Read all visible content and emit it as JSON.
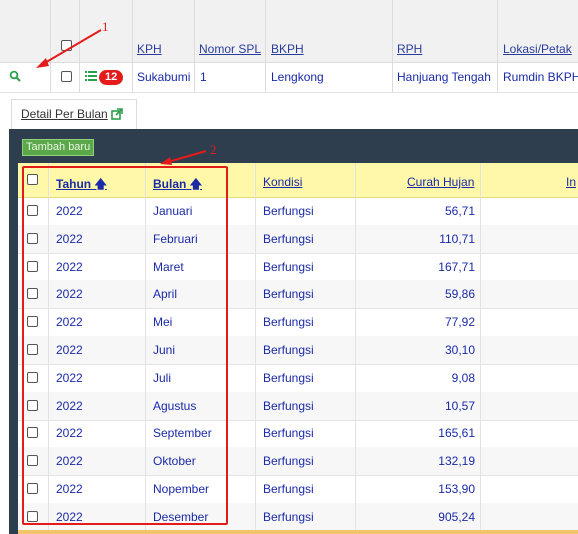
{
  "top_table": {
    "columns": [
      "KPH",
      "Nomor SPL",
      "BKPH",
      "RPH",
      "Lokasi/Petak"
    ],
    "row": {
      "badge_count": "12",
      "kph": "Sukabumi",
      "nomor_spl": "1",
      "bkph": "Lengkong",
      "rph": "Hanjuang Tengah",
      "lokasi": "Rumdin BKPH"
    }
  },
  "tab": {
    "label": "Detail Per Bulan"
  },
  "toolbar": {
    "add_label": "Tambah baru"
  },
  "detail_table": {
    "headers": {
      "tahun": "Tahun",
      "bulan": "Bulan",
      "kondisi": "Kondisi",
      "curah_hujan": "Curah Hujan",
      "next": "In"
    },
    "rows": [
      {
        "tahun": "2022",
        "bulan": "Januari",
        "kondisi": "Berfungsi",
        "curah": "56,71"
      },
      {
        "tahun": "2022",
        "bulan": "Februari",
        "kondisi": "Berfungsi",
        "curah": "110,71"
      },
      {
        "tahun": "2022",
        "bulan": "Maret",
        "kondisi": "Berfungsi",
        "curah": "167,71"
      },
      {
        "tahun": "2022",
        "bulan": "April",
        "kondisi": "Berfungsi",
        "curah": "59,86"
      },
      {
        "tahun": "2022",
        "bulan": "Mei",
        "kondisi": "Berfungsi",
        "curah": "77,92"
      },
      {
        "tahun": "2022",
        "bulan": "Juni",
        "kondisi": "Berfungsi",
        "curah": "30,10"
      },
      {
        "tahun": "2022",
        "bulan": "Juli",
        "kondisi": "Berfungsi",
        "curah": "9,08"
      },
      {
        "tahun": "2022",
        "bulan": "Agustus",
        "kondisi": "Berfungsi",
        "curah": "10,57"
      },
      {
        "tahun": "2022",
        "bulan": "September",
        "kondisi": "Berfungsi",
        "curah": "165,61"
      },
      {
        "tahun": "2022",
        "bulan": "Oktober",
        "kondisi": "Berfungsi",
        "curah": "132,19"
      },
      {
        "tahun": "2022",
        "bulan": "Nopember",
        "kondisi": "Berfungsi",
        "curah": "153,90"
      },
      {
        "tahun": "2022",
        "bulan": "Desember",
        "kondisi": "Berfungsi",
        "curah": "905,24"
      }
    ]
  },
  "annotations": {
    "label_1": "1",
    "label_2": "2"
  },
  "colors": {
    "accent_red": "#e31b1b",
    "header_yellow": "#fff8a8",
    "link_blue": "#1a2aa8",
    "panel_dark": "#2f3e4f",
    "button_green": "#5aa84a"
  },
  "icons": [
    "search-icon",
    "list-icon",
    "external-link-icon",
    "sort-asc-icon"
  ]
}
